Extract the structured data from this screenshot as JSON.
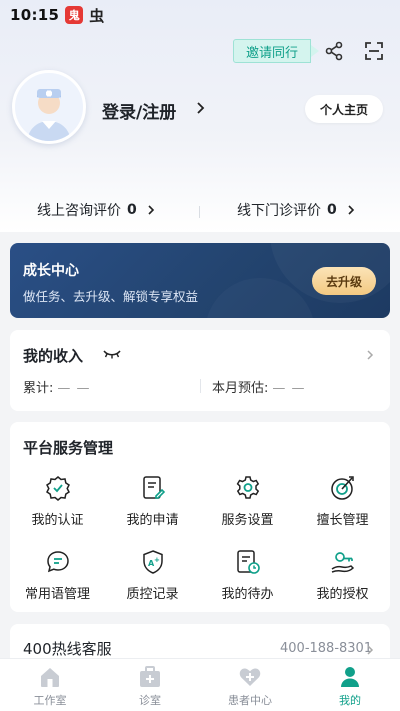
{
  "status_bar": {
    "time": "10:15",
    "app_badge_char": "鬼",
    "app_icon_char": "虫"
  },
  "header": {
    "invite_label": "邀请同行",
    "share_icon": "share-icon",
    "scan_icon": "scan-icon"
  },
  "profile": {
    "login_label": "登录/注册",
    "homepage_label": "个人主页"
  },
  "evaluations": {
    "online_label": "线上咨询评价",
    "online_count": "0",
    "offline_label": "线下门诊评价",
    "offline_count": "0"
  },
  "growth": {
    "title": "成长中心",
    "subtitle": "做任务、去升级、解锁专享权益",
    "button_label": "去升级"
  },
  "income": {
    "title": "我的收入",
    "total_label": "累计:",
    "total_value": "— —",
    "month_label": "本月预估:",
    "month_value": "— —"
  },
  "services": {
    "title": "平台服务管理",
    "items": [
      {
        "label": "我的认证",
        "icon": "certification-icon"
      },
      {
        "label": "我的申请",
        "icon": "application-icon"
      },
      {
        "label": "服务设置",
        "icon": "settings-icon"
      },
      {
        "label": "擅长管理",
        "icon": "target-icon"
      },
      {
        "label": "常用语管理",
        "icon": "chat-icon"
      },
      {
        "label": "质控记录",
        "icon": "shield-icon"
      },
      {
        "label": "我的待办",
        "icon": "todo-icon"
      },
      {
        "label": "我的授权",
        "icon": "key-icon"
      }
    ]
  },
  "hotline": {
    "title": "400热线客服",
    "number": "400-188-8301"
  },
  "tabbar": {
    "items": [
      {
        "label": "工作室",
        "icon": "home-icon",
        "active": false
      },
      {
        "label": "诊室",
        "icon": "clinic-icon",
        "active": false
      },
      {
        "label": "患者中心",
        "icon": "heart-icon",
        "active": false
      },
      {
        "label": "我的",
        "icon": "profile-icon",
        "active": true
      }
    ]
  },
  "colors": {
    "accent": "#10a08a",
    "growth_bg": "#23446f",
    "upgrade_btn": "#f3c982"
  }
}
